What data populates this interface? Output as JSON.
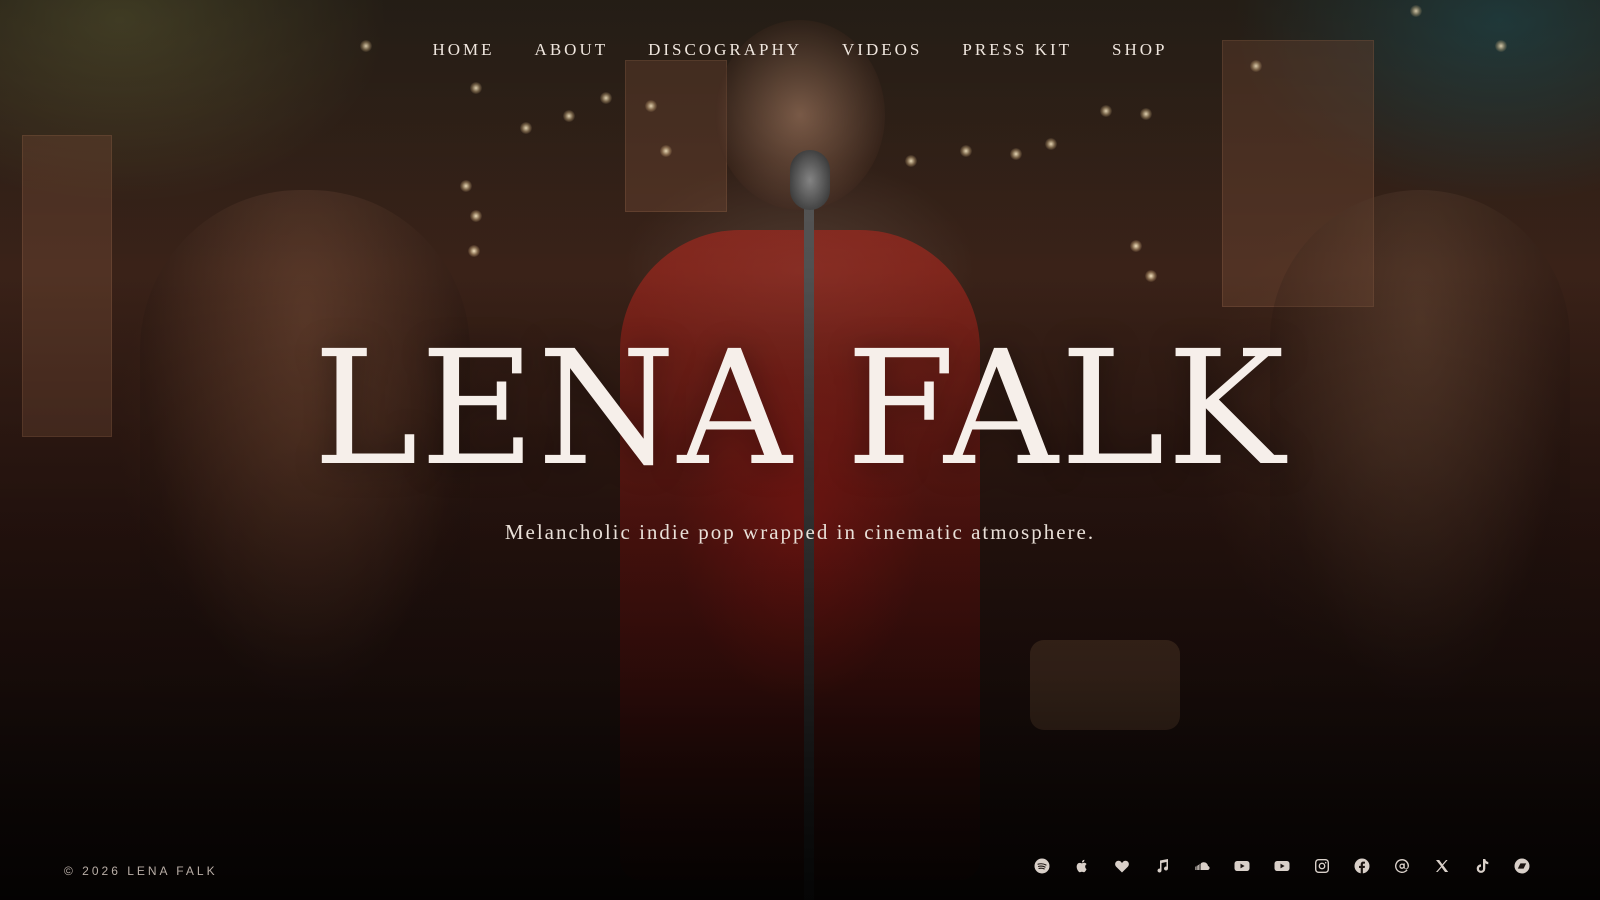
{
  "nav": {
    "items": [
      "HOME",
      "ABOUT",
      "DISCOGRAPHY",
      "VIDEOS",
      "PRESS KIT",
      "SHOP"
    ]
  },
  "hero": {
    "title": "LENA FALK",
    "tagline": "Melancholic indie pop wrapped in cinematic atmosphere."
  },
  "footer": {
    "copyright": "© 2026 LENA FALK"
  },
  "socials": [
    "spotify-icon",
    "apple-music-icon",
    "heart-icon",
    "music-note-icon",
    "soundcloud-icon",
    "youtube-icon",
    "youtube-music-icon",
    "instagram-icon",
    "facebook-icon",
    "threads-icon",
    "x-icon",
    "tiktok-icon",
    "bandcamp-icon"
  ],
  "colors": {
    "text": "#f6efea",
    "dress_red": "#961c18",
    "background": "#120c0a"
  }
}
